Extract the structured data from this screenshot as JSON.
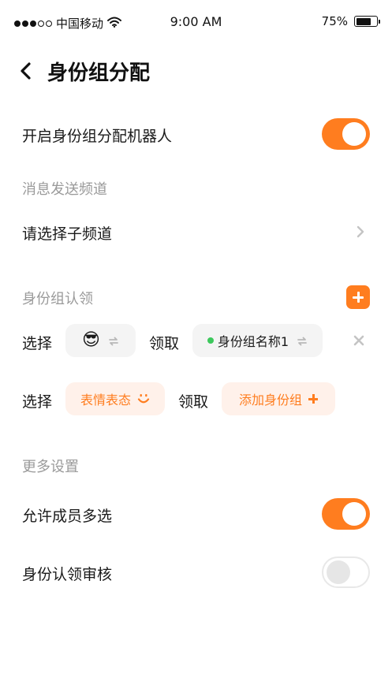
{
  "status_bar": {
    "carrier": "中国移动",
    "time": "9:00 AM",
    "battery_percent": "75%",
    "battery_level": 0.75,
    "signal_strength": 3,
    "signal_max": 5
  },
  "nav": {
    "title": "身份组分配"
  },
  "bot_toggle": {
    "label": "开启身份组分配机器人",
    "on": true
  },
  "channel_section": {
    "title": "消息发送频道",
    "select_label": "请选择子频道"
  },
  "claim_section": {
    "title": "身份组认领",
    "rows": [
      {
        "select_label": "选择",
        "emoji": "😎",
        "claim_label": "领取",
        "role_name": "身份组名称1"
      },
      {
        "select_label": "选择",
        "emoji_placeholder": "表情表态",
        "claim_label": "领取",
        "role_placeholder": "添加身份组"
      }
    ]
  },
  "more_section": {
    "title": "更多设置",
    "multi_select": {
      "label": "允许成员多选",
      "on": true
    },
    "claim_review": {
      "label": "身份认领审核",
      "on": false
    }
  },
  "colors": {
    "accent": "#ff7d1f",
    "accent_light": "#fff1ea",
    "online": "#3cc85c"
  }
}
